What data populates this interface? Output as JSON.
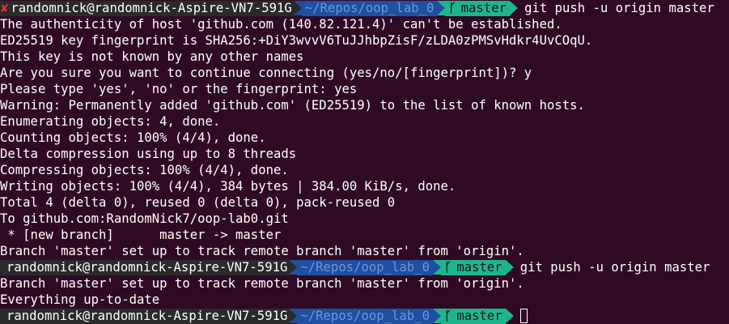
{
  "terminal": {
    "prompt_user": "randomnick@randomnick-Aspire-VN7-591G",
    "prompt_path": "~/Repos/oop_lab_0",
    "prompt_branch": "master",
    "error_mark": "✘",
    "icons": {
      "error": "cross-mark-icon",
      "branch": "git-branch-icon"
    },
    "colors": {
      "background": "#300a24",
      "user_segment": "#2a2a2a",
      "path_segment": "#1e4fa0",
      "git_segment": "#1fb58c",
      "error": "#e0352b"
    },
    "first_command": "git push -u origin master",
    "output1": [
      "The authenticity of host 'github.com (140.82.121.4)' can't be established.",
      "ED25519 key fingerprint is SHA256:+DiY3wvvV6TuJJhbpZisF/zLDA0zPMSvHdkr4UvCOqU.",
      "This key is not known by any other names",
      "Are you sure you want to continue connecting (yes/no/[fingerprint])? y",
      "Please type 'yes', 'no' or the fingerprint: yes",
      "Warning: Permanently added 'github.com' (ED25519) to the list of known hosts.",
      "Enumerating objects: 4, done.",
      "Counting objects: 100% (4/4), done.",
      "Delta compression using up to 8 threads",
      "Compressing objects: 100% (4/4), done.",
      "Writing objects: 100% (4/4), 384 bytes | 384.00 KiB/s, done.",
      "Total 4 (delta 0), reused 0 (delta 0), pack-reused 0",
      "To github.com:RandomNick7/oop-lab0.git",
      " * [new branch]      master -> master",
      "Branch 'master' set up to track remote branch 'master' from 'origin'."
    ],
    "second_command": "git push -u origin master",
    "output2": [
      "Branch 'master' set up to track remote branch 'master' from 'origin'.",
      "Everything up-to-date"
    ]
  }
}
